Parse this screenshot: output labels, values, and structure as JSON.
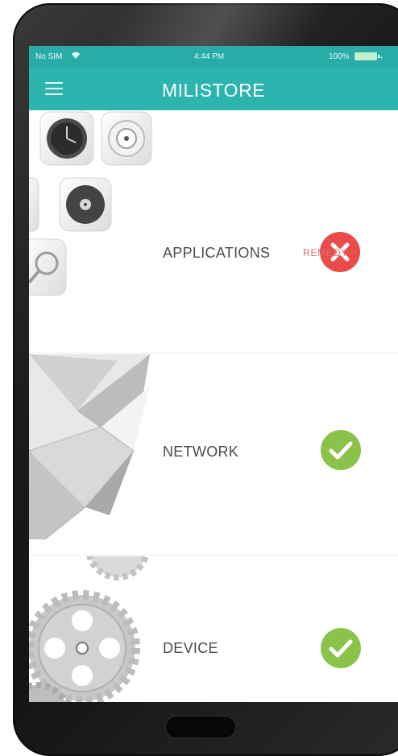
{
  "statusbar": {
    "carrier": "No SIM",
    "time": "4:44 PM",
    "battery": "100%"
  },
  "header": {
    "title": "MILISTORE",
    "menu_icon": "hamburger-menu-icon",
    "background": "#2eb4af"
  },
  "checks": [
    {
      "label": "APPLICATIONS",
      "status": "fail",
      "status_icon": "x-circle-icon",
      "color": "#e94b4b",
      "action": "REMEDY >"
    },
    {
      "label": "NETWORK",
      "status": "ok",
      "status_icon": "check-circle-icon",
      "color": "#8bc34a"
    },
    {
      "label": "DEVICE",
      "status": "ok",
      "status_icon": "check-circle-icon",
      "color": "#8bc34a"
    }
  ]
}
